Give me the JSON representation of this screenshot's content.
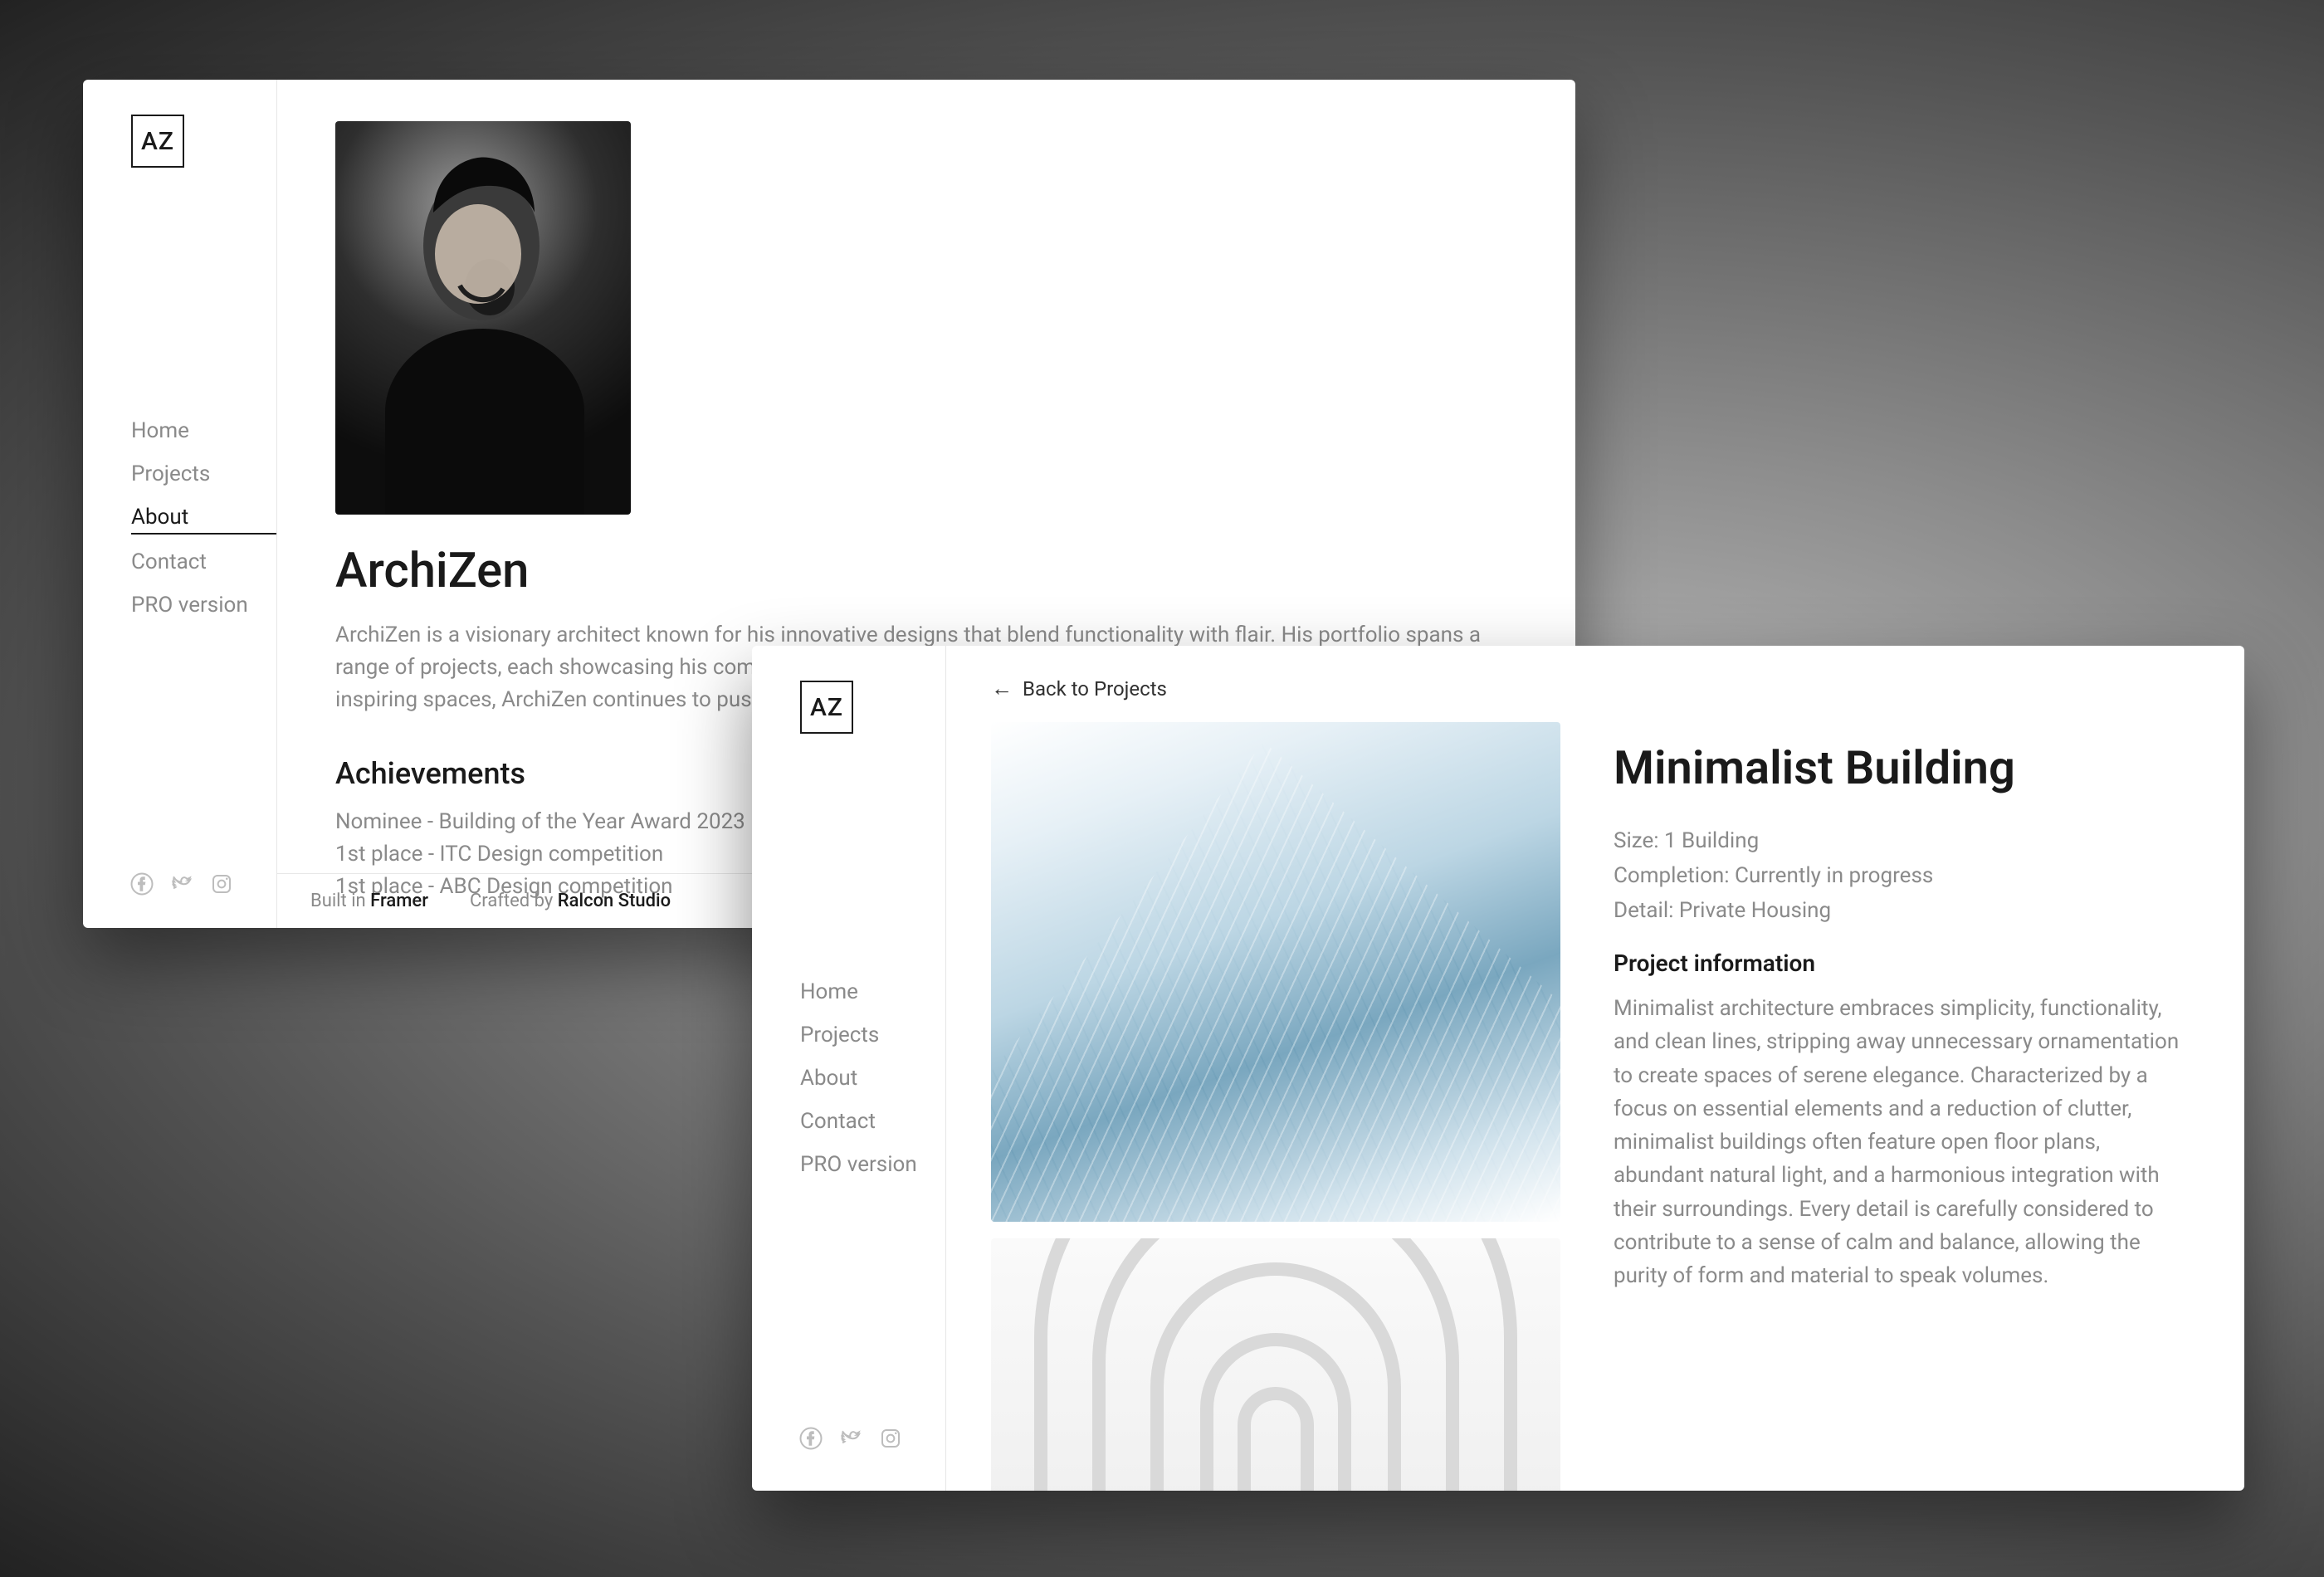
{
  "logo_text": "AZ",
  "nav_items": [
    "Home",
    "Projects",
    "About",
    "Contact",
    "PRO version"
  ],
  "about": {
    "title": "ArchiZen",
    "blurb": "ArchiZen is a visionary architect known for his innovative designs that blend functionality with flair. His portfolio spans a range of projects, each showcasing his commitment to excellence and keen eye for detail. With a passion for creating inspiring spaces, ArchiZen continues to push boundaries in the field of architecture.",
    "achievements_heading": "Achievements",
    "achievements": [
      "Nominee - Building of the Year Award 2023",
      "1st place - ITC Design competition",
      "1st place - ABC Design competition"
    ],
    "active_nav": "About",
    "footer_built_prefix": "Built in ",
    "footer_built_link": "Framer",
    "footer_crafted_prefix": "Crafted by ",
    "footer_crafted_link": "Ralcon Studio"
  },
  "project": {
    "back_label": "Back to Projects",
    "title": "Minimalist Building",
    "meta": {
      "size_label": "Size:",
      "size_value": "1 Building",
      "completion_label": "Completion:",
      "completion_value": "Currently in progress",
      "detail_label": "Detail:",
      "detail_value": "Private Housing"
    },
    "info_heading": "Project information",
    "info_body": "Minimalist architecture embraces simplicity, functionality, and clean lines, stripping away unnecessary ornamentation to create spaces of serene elegance. Characterized by a focus on essential elements and a reduction of clutter, minimalist buildings often feature open floor plans, abundant natural light, and a harmonious integration with their surroundings. Every detail is carefully considered to contribute to a sense of calm and balance, allowing the purity of form and material to speak volumes.",
    "active_nav": ""
  },
  "social_icons": [
    "facebook-icon",
    "twitter-icon",
    "instagram-icon"
  ]
}
